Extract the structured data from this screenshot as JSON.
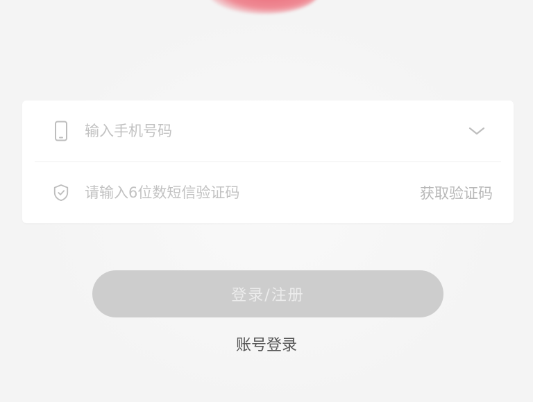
{
  "colors": {
    "background": "#f4f4f4",
    "card": "#ffffff",
    "logo": "#e96473",
    "placeholder": "#c2c2c2",
    "button_disabled": "#cdcdcd",
    "link_text": "#555555"
  },
  "icons": {
    "logo": "logo-icon",
    "phone": "phone-icon",
    "shield": "shield-icon",
    "dropdown": "chevron-down-icon"
  },
  "form": {
    "phone": {
      "value": "",
      "placeholder": "输入手机号码"
    },
    "code": {
      "value": "",
      "placeholder": "请输入6位数短信验证码",
      "get_code_label": "获取验证码"
    }
  },
  "actions": {
    "login_label": "登录/注册",
    "account_login_label": "账号登录"
  }
}
